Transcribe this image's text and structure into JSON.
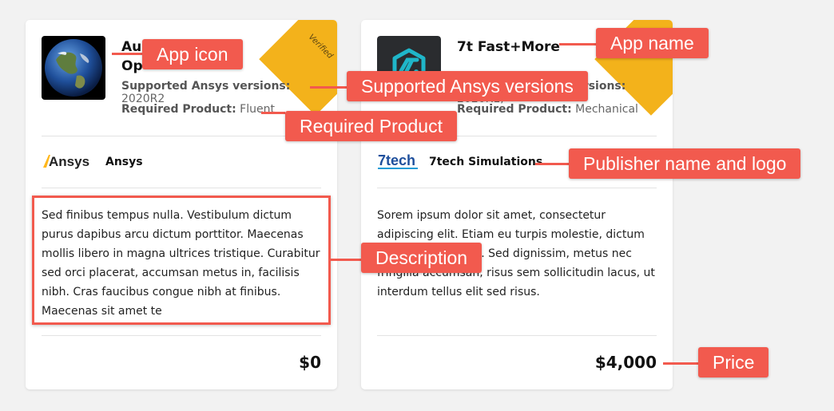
{
  "cards": [
    {
      "badge": "Verified",
      "title_line1": "Au",
      "title_line2": "Op",
      "supported_label": "Supported Ansys versions:",
      "supported_value": "2020R2",
      "required_label": "Required Product:",
      "required_value": "Fluent",
      "publisher_logo_text": "Ansys",
      "publisher_name": "Ansys",
      "description": "Sed finibus tempus nulla. Vestibulum dictum purus dapibus arcu dictum porttitor. Maecenas mollis libero in magna ultrices tristique. Curabitur sed orci placerat, accumsan metus in, facilisis nibh. Cras faucibus congue nibh at finibus. Maecenas sit amet te",
      "price": "$0"
    },
    {
      "title": "7t Fast+More",
      "supported_label": "Supported Ansys versions:",
      "supported_value": "2020R1,",
      "required_label": "Required Product:",
      "required_value": "Mechanical",
      "publisher_logo_text": "7tech",
      "publisher_name": "7tech Simulations",
      "description": "Sorem ipsum dolor sit amet, consectetur adipiscing elit. Etiam eu turpis molestie, dictum est a, mattis tellus. Sed dignissim, metus nec fringilla accumsan, risus sem sollicitudin lacus, ut interdum tellus elit sed risus.",
      "price": "$4,000"
    }
  ],
  "annotations": {
    "app_icon": "App icon",
    "app_name": "App name",
    "supported_versions": "Supported Ansys versions",
    "required_product": "Required Product",
    "publisher": "Publisher name and logo",
    "description": "Description",
    "price": "Price"
  },
  "colors": {
    "annotation": "#f25a4e",
    "ribbon": "#f3b21b",
    "page_bg": "#f2f2f2"
  }
}
